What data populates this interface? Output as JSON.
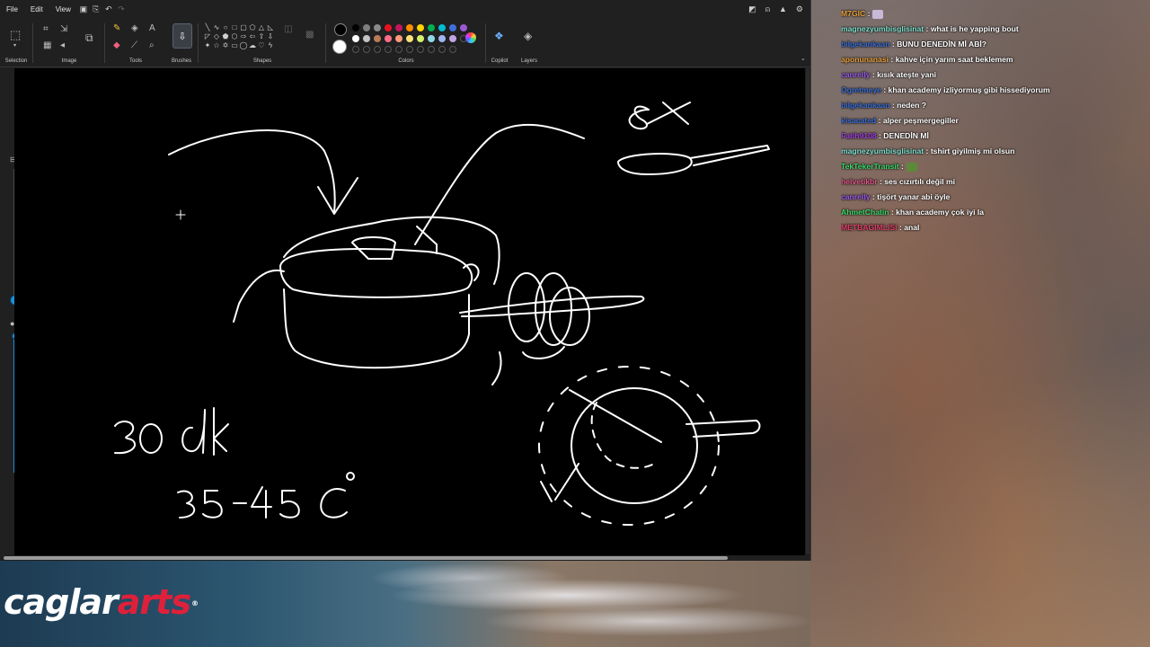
{
  "menu": {
    "items": [
      "File",
      "Edit",
      "View"
    ]
  },
  "ribbon": {
    "groups": {
      "selection": "Selection",
      "image": "Image",
      "tools": "Tools",
      "brushes": "Brushes",
      "shapes": "Shapes",
      "colors": "Colors",
      "copilot": "Copilot",
      "layers": "Layers"
    },
    "palette": [
      "#000000",
      "#7f7f7f",
      "#8a8a8a",
      "#e81123",
      "#c2185b",
      "#ff8c00",
      "#ffd500",
      "#00b050",
      "#00bcd4",
      "#3f6fd8",
      "#9b59d0",
      "#ffffff",
      "#c3c3c3",
      "#b97a57",
      "#ff6d8a",
      "#ff9a7a",
      "#ffe27a",
      "#d4f06a",
      "#8fd8e8",
      "#9fb4f0",
      "#c3a3e0"
    ],
    "primary_color": "#000000",
    "secondary_color": "#ffffff"
  },
  "canvas": {
    "background": "#000000",
    "stroke_color": "#ffffff",
    "drawn_text": [
      "8x",
      "30 dk",
      "35-45 C°"
    ]
  },
  "chat": {
    "messages": [
      {
        "user": "M7GIC",
        "user_color": "#e8a23a",
        "text": "",
        "emote": true
      },
      {
        "user": "magnezyumbisglisinat",
        "user_color": "#7fe0d0",
        "text": "what is he yapping bout"
      },
      {
        "user": "bilgekankaan",
        "user_color": "#3a6fd8",
        "text": "BUNU DENEDİN Mİ ABİ?"
      },
      {
        "user": "aponunanasi",
        "user_color": "#e8a23a",
        "text": "kahve için yarım saat beklemem"
      },
      {
        "user": "canrelly",
        "user_color": "#9a5cf0",
        "text": "kısık ateşte yani"
      },
      {
        "user": "Ogretmeye",
        "user_color": "#3a6fd8",
        "text": "khan academy izliyormuş gibi hissediyorum"
      },
      {
        "user": "bilgekankaan",
        "user_color": "#3a6fd8",
        "text": "neden ?"
      },
      {
        "user": "kisacated",
        "user_color": "#3a6fd8",
        "text": "alper peşmergegiller"
      },
      {
        "user": "Fatih9108",
        "user_color": "#a040e0",
        "text": "DENEDİN Mİ"
      },
      {
        "user": "magnezyumbisglisinat",
        "user_color": "#7fe0d0",
        "text": "tshirt giyilmiş mi olsun"
      },
      {
        "user": "TekTekerTransit",
        "user_color": "#3ad86a",
        "text": "",
        "emote": true
      },
      {
        "user": "helvetikbr",
        "user_color": "#e05a8a",
        "text": "ses cızırtılı değil mi"
      },
      {
        "user": "canrelly",
        "user_color": "#9a5cf0",
        "text": "tişört yanar abi öyle"
      },
      {
        "user": "AhmetChatin",
        "user_color": "#3ad86a",
        "text": "khan academy çok iyi la"
      },
      {
        "user": "METBAGIMLISI",
        "user_color": "#e0406a",
        "text": "anal"
      }
    ]
  },
  "logo": {
    "part1": "caglar",
    "part2": "arts",
    "mark": "®"
  }
}
